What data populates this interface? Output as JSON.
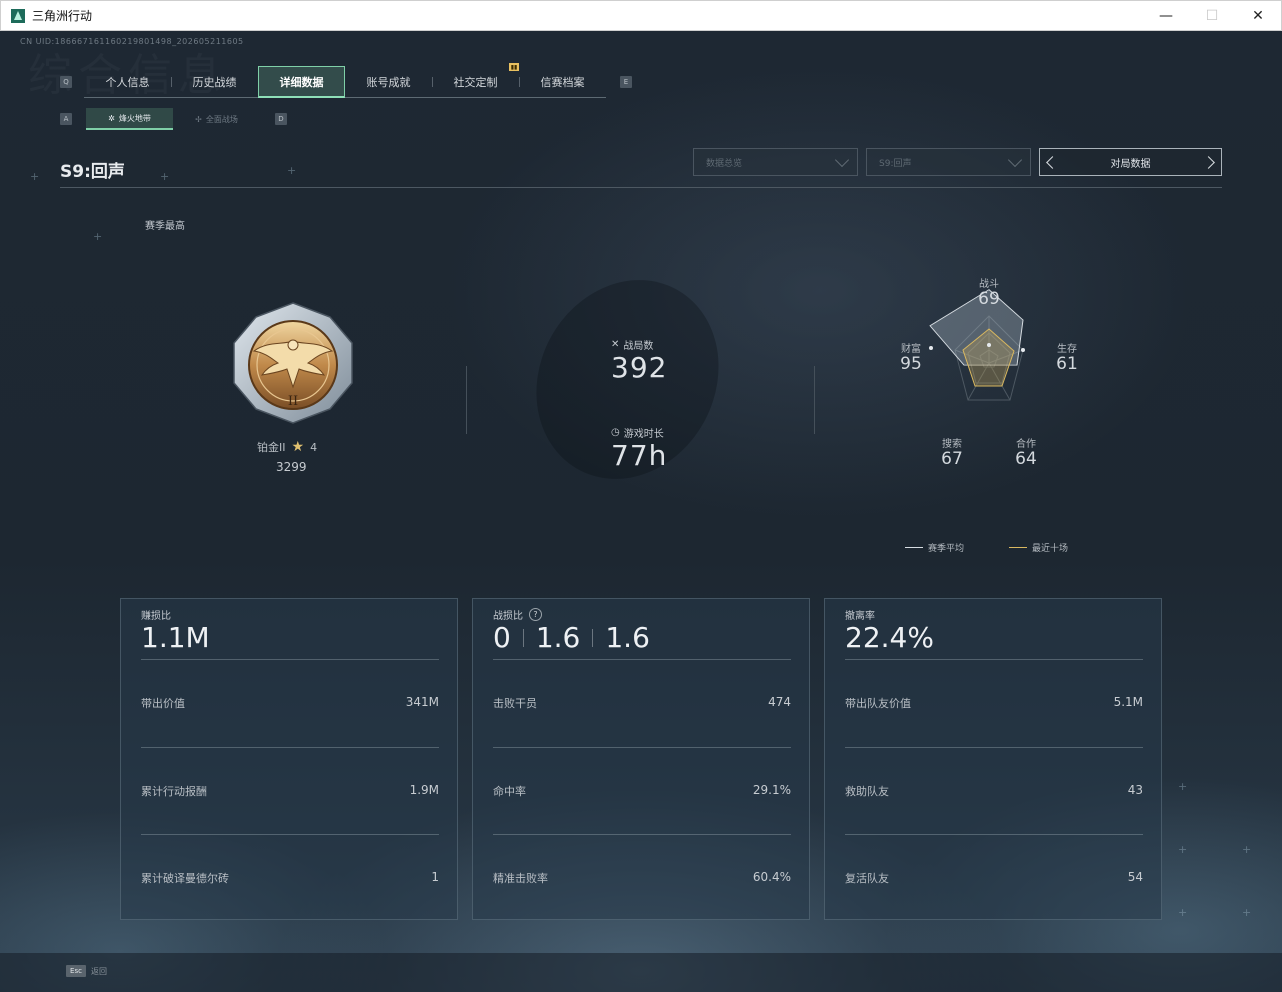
{
  "window": {
    "title": "三角洲行动",
    "controls": {
      "minimize": "—",
      "maximize": "☐",
      "close": "✕"
    }
  },
  "cn_id": "CN UID:186667161160219801498_202605211605",
  "watermark": "综合信息",
  "main_tabs": {
    "key_left": "Q",
    "key_right": "E",
    "items": [
      "个人信息",
      "历史战绩",
      "详细数据",
      "账号成就",
      "社交定制",
      "信赛档案"
    ],
    "active_index": 2
  },
  "sub_tabs": {
    "key_left": "A",
    "key_right": "D",
    "items": [
      "烽火地带",
      "全面战场"
    ],
    "active_index": 0
  },
  "season": {
    "title": "S9:回声",
    "filters": [
      "数据总览",
      "S9:回声"
    ],
    "pager_label": "对局数据",
    "best_label": "赛季最高"
  },
  "rank": {
    "name": "铂金II",
    "stars": "4",
    "points": "3299",
    "numeral": "II"
  },
  "matches": {
    "label": "战局数",
    "value": "392"
  },
  "playtime": {
    "label": "游戏时长",
    "value": "77h"
  },
  "radar": {
    "axes": [
      {
        "label": "战斗",
        "value": "69"
      },
      {
        "label": "生存",
        "value": "61"
      },
      {
        "label": "合作",
        "value": "64"
      },
      {
        "label": "搜索",
        "value": "67"
      },
      {
        "label": "财富",
        "value": "95"
      }
    ],
    "legend": [
      "赛季平均",
      "最近十场"
    ],
    "colors": {
      "season_avg": "#d7dde2",
      "recent": "#d9b860"
    }
  },
  "cards": [
    {
      "title": "赚损比",
      "big": [
        "1.1M"
      ],
      "rows": [
        {
          "label": "带出价值",
          "value": "341M"
        },
        {
          "label": "累计行动报酬",
          "value": "1.9M"
        },
        {
          "label": "累计破译曼德尔砖",
          "value": "1"
        }
      ]
    },
    {
      "title": "战损比",
      "help": "?",
      "big": [
        "0",
        "1.6",
        "1.6"
      ],
      "rows": [
        {
          "label": "击败干员",
          "value": "474"
        },
        {
          "label": "命中率",
          "value": "29.1%"
        },
        {
          "label": "精准击败率",
          "value": "60.4%"
        }
      ]
    },
    {
      "title": "撤离率",
      "big": [
        "22.4%"
      ],
      "rows": [
        {
          "label": "带出队友价值",
          "value": "5.1M"
        },
        {
          "label": "救助队友",
          "value": "43"
        },
        {
          "label": "复活队友",
          "value": "54"
        }
      ]
    }
  ],
  "footer": {
    "esc_key": "Esc",
    "esc_label": "返回"
  }
}
